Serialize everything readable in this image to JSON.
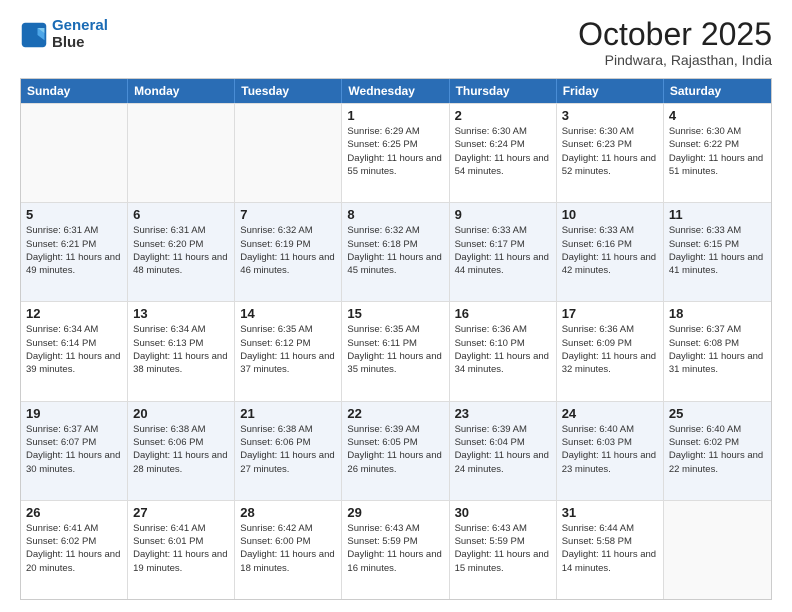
{
  "header": {
    "logo_line1": "General",
    "logo_line2": "Blue",
    "title": "October 2025",
    "subtitle": "Pindwara, Rajasthan, India"
  },
  "weekdays": [
    "Sunday",
    "Monday",
    "Tuesday",
    "Wednesday",
    "Thursday",
    "Friday",
    "Saturday"
  ],
  "weeks": [
    [
      {
        "day": "",
        "sunrise": "",
        "sunset": "",
        "daylight": "",
        "empty": true
      },
      {
        "day": "",
        "sunrise": "",
        "sunset": "",
        "daylight": "",
        "empty": true
      },
      {
        "day": "",
        "sunrise": "",
        "sunset": "",
        "daylight": "",
        "empty": true
      },
      {
        "day": "1",
        "sunrise": "Sunrise: 6:29 AM",
        "sunset": "Sunset: 6:25 PM",
        "daylight": "Daylight: 11 hours and 55 minutes."
      },
      {
        "day": "2",
        "sunrise": "Sunrise: 6:30 AM",
        "sunset": "Sunset: 6:24 PM",
        "daylight": "Daylight: 11 hours and 54 minutes."
      },
      {
        "day": "3",
        "sunrise": "Sunrise: 6:30 AM",
        "sunset": "Sunset: 6:23 PM",
        "daylight": "Daylight: 11 hours and 52 minutes."
      },
      {
        "day": "4",
        "sunrise": "Sunrise: 6:30 AM",
        "sunset": "Sunset: 6:22 PM",
        "daylight": "Daylight: 11 hours and 51 minutes."
      }
    ],
    [
      {
        "day": "5",
        "sunrise": "Sunrise: 6:31 AM",
        "sunset": "Sunset: 6:21 PM",
        "daylight": "Daylight: 11 hours and 49 minutes."
      },
      {
        "day": "6",
        "sunrise": "Sunrise: 6:31 AM",
        "sunset": "Sunset: 6:20 PM",
        "daylight": "Daylight: 11 hours and 48 minutes."
      },
      {
        "day": "7",
        "sunrise": "Sunrise: 6:32 AM",
        "sunset": "Sunset: 6:19 PM",
        "daylight": "Daylight: 11 hours and 46 minutes."
      },
      {
        "day": "8",
        "sunrise": "Sunrise: 6:32 AM",
        "sunset": "Sunset: 6:18 PM",
        "daylight": "Daylight: 11 hours and 45 minutes."
      },
      {
        "day": "9",
        "sunrise": "Sunrise: 6:33 AM",
        "sunset": "Sunset: 6:17 PM",
        "daylight": "Daylight: 11 hours and 44 minutes."
      },
      {
        "day": "10",
        "sunrise": "Sunrise: 6:33 AM",
        "sunset": "Sunset: 6:16 PM",
        "daylight": "Daylight: 11 hours and 42 minutes."
      },
      {
        "day": "11",
        "sunrise": "Sunrise: 6:33 AM",
        "sunset": "Sunset: 6:15 PM",
        "daylight": "Daylight: 11 hours and 41 minutes."
      }
    ],
    [
      {
        "day": "12",
        "sunrise": "Sunrise: 6:34 AM",
        "sunset": "Sunset: 6:14 PM",
        "daylight": "Daylight: 11 hours and 39 minutes."
      },
      {
        "day": "13",
        "sunrise": "Sunrise: 6:34 AM",
        "sunset": "Sunset: 6:13 PM",
        "daylight": "Daylight: 11 hours and 38 minutes."
      },
      {
        "day": "14",
        "sunrise": "Sunrise: 6:35 AM",
        "sunset": "Sunset: 6:12 PM",
        "daylight": "Daylight: 11 hours and 37 minutes."
      },
      {
        "day": "15",
        "sunrise": "Sunrise: 6:35 AM",
        "sunset": "Sunset: 6:11 PM",
        "daylight": "Daylight: 11 hours and 35 minutes."
      },
      {
        "day": "16",
        "sunrise": "Sunrise: 6:36 AM",
        "sunset": "Sunset: 6:10 PM",
        "daylight": "Daylight: 11 hours and 34 minutes."
      },
      {
        "day": "17",
        "sunrise": "Sunrise: 6:36 AM",
        "sunset": "Sunset: 6:09 PM",
        "daylight": "Daylight: 11 hours and 32 minutes."
      },
      {
        "day": "18",
        "sunrise": "Sunrise: 6:37 AM",
        "sunset": "Sunset: 6:08 PM",
        "daylight": "Daylight: 11 hours and 31 minutes."
      }
    ],
    [
      {
        "day": "19",
        "sunrise": "Sunrise: 6:37 AM",
        "sunset": "Sunset: 6:07 PM",
        "daylight": "Daylight: 11 hours and 30 minutes."
      },
      {
        "day": "20",
        "sunrise": "Sunrise: 6:38 AM",
        "sunset": "Sunset: 6:06 PM",
        "daylight": "Daylight: 11 hours and 28 minutes."
      },
      {
        "day": "21",
        "sunrise": "Sunrise: 6:38 AM",
        "sunset": "Sunset: 6:06 PM",
        "daylight": "Daylight: 11 hours and 27 minutes."
      },
      {
        "day": "22",
        "sunrise": "Sunrise: 6:39 AM",
        "sunset": "Sunset: 6:05 PM",
        "daylight": "Daylight: 11 hours and 26 minutes."
      },
      {
        "day": "23",
        "sunrise": "Sunrise: 6:39 AM",
        "sunset": "Sunset: 6:04 PM",
        "daylight": "Daylight: 11 hours and 24 minutes."
      },
      {
        "day": "24",
        "sunrise": "Sunrise: 6:40 AM",
        "sunset": "Sunset: 6:03 PM",
        "daylight": "Daylight: 11 hours and 23 minutes."
      },
      {
        "day": "25",
        "sunrise": "Sunrise: 6:40 AM",
        "sunset": "Sunset: 6:02 PM",
        "daylight": "Daylight: 11 hours and 22 minutes."
      }
    ],
    [
      {
        "day": "26",
        "sunrise": "Sunrise: 6:41 AM",
        "sunset": "Sunset: 6:02 PM",
        "daylight": "Daylight: 11 hours and 20 minutes."
      },
      {
        "day": "27",
        "sunrise": "Sunrise: 6:41 AM",
        "sunset": "Sunset: 6:01 PM",
        "daylight": "Daylight: 11 hours and 19 minutes."
      },
      {
        "day": "28",
        "sunrise": "Sunrise: 6:42 AM",
        "sunset": "Sunset: 6:00 PM",
        "daylight": "Daylight: 11 hours and 18 minutes."
      },
      {
        "day": "29",
        "sunrise": "Sunrise: 6:43 AM",
        "sunset": "Sunset: 5:59 PM",
        "daylight": "Daylight: 11 hours and 16 minutes."
      },
      {
        "day": "30",
        "sunrise": "Sunrise: 6:43 AM",
        "sunset": "Sunset: 5:59 PM",
        "daylight": "Daylight: 11 hours and 15 minutes."
      },
      {
        "day": "31",
        "sunrise": "Sunrise: 6:44 AM",
        "sunset": "Sunset: 5:58 PM",
        "daylight": "Daylight: 11 hours and 14 minutes."
      },
      {
        "day": "",
        "sunrise": "",
        "sunset": "",
        "daylight": "",
        "empty": true
      }
    ]
  ]
}
